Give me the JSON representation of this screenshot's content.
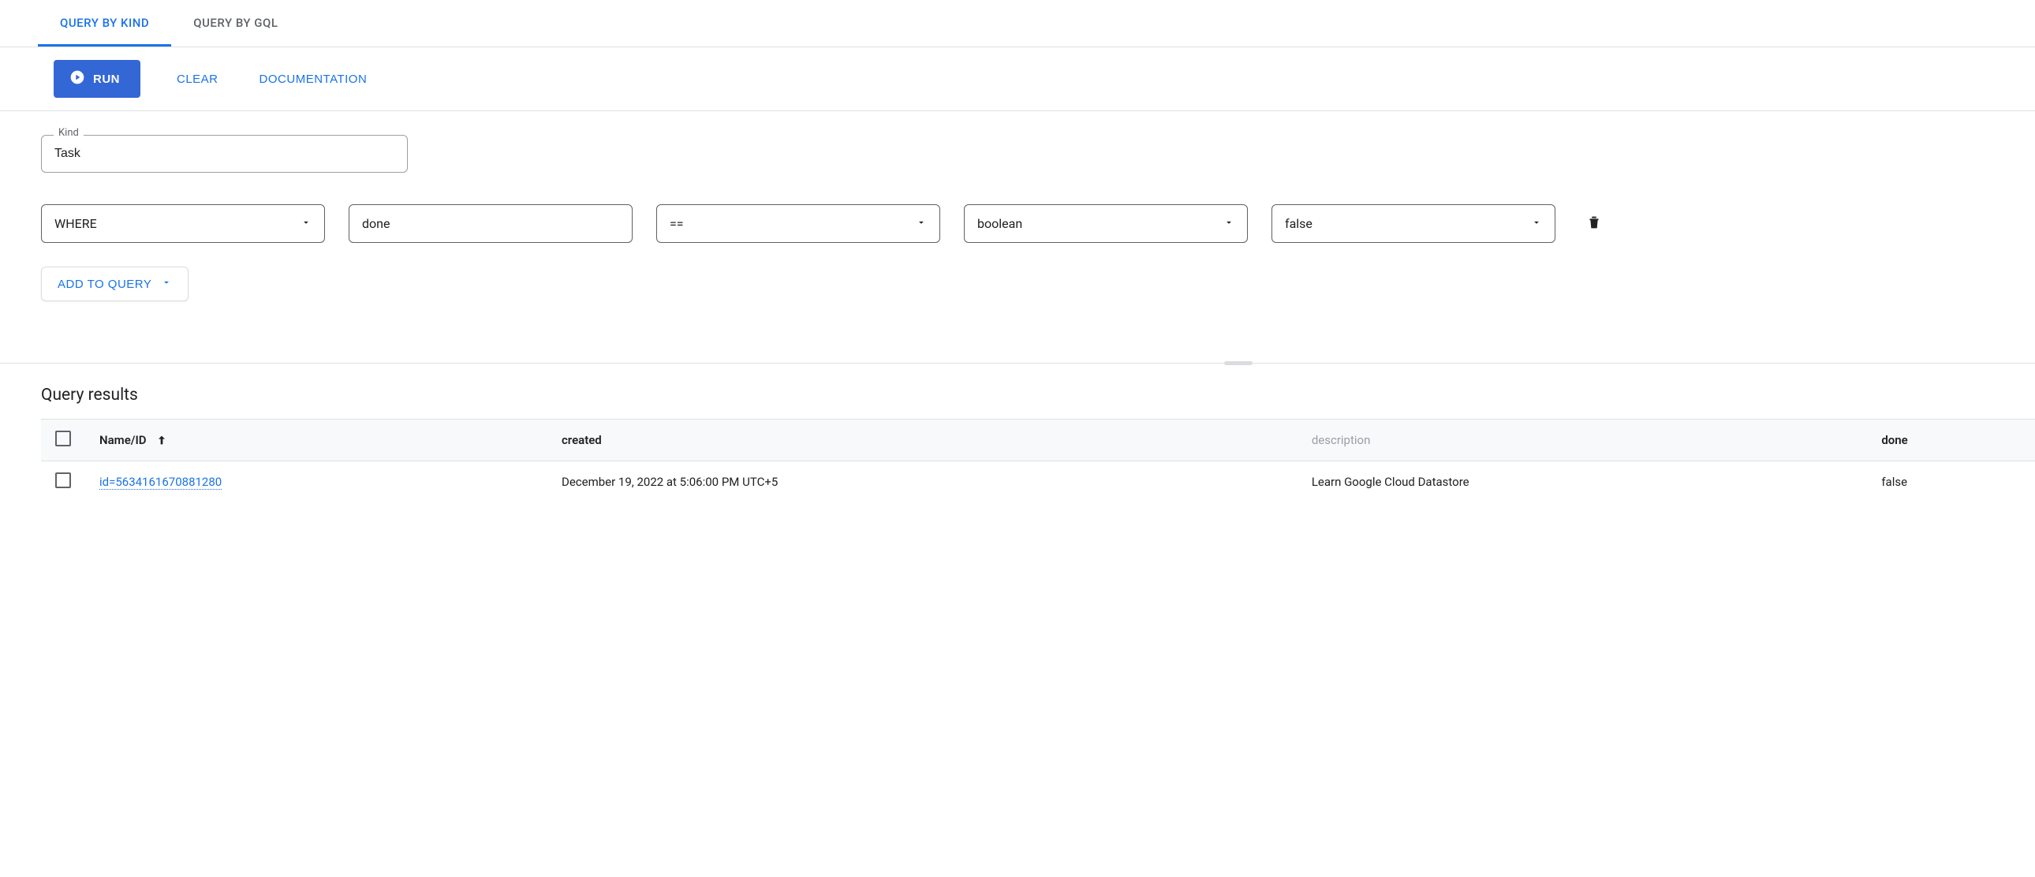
{
  "tabs": {
    "active": "QUERY BY KIND",
    "gql": "QUERY BY GQL"
  },
  "toolbar": {
    "run": "RUN",
    "clear": "CLEAR",
    "docs": "DOCUMENTATION"
  },
  "builder": {
    "kind_label": "Kind",
    "kind_value": "Task",
    "filter": {
      "clause": "WHERE",
      "property": "done",
      "operator": "==",
      "type": "boolean",
      "value": "false"
    },
    "add_to_query": "ADD TO QUERY"
  },
  "results": {
    "title": "Query results",
    "columns": {
      "name_id": "Name/ID",
      "created": "created",
      "description": "description",
      "done": "done"
    },
    "rows": [
      {
        "id": "id=5634161670881280",
        "created": "December 19, 2022 at 5:06:00 PM UTC+5",
        "description": "Learn Google Cloud Datastore",
        "done": "false"
      }
    ]
  }
}
